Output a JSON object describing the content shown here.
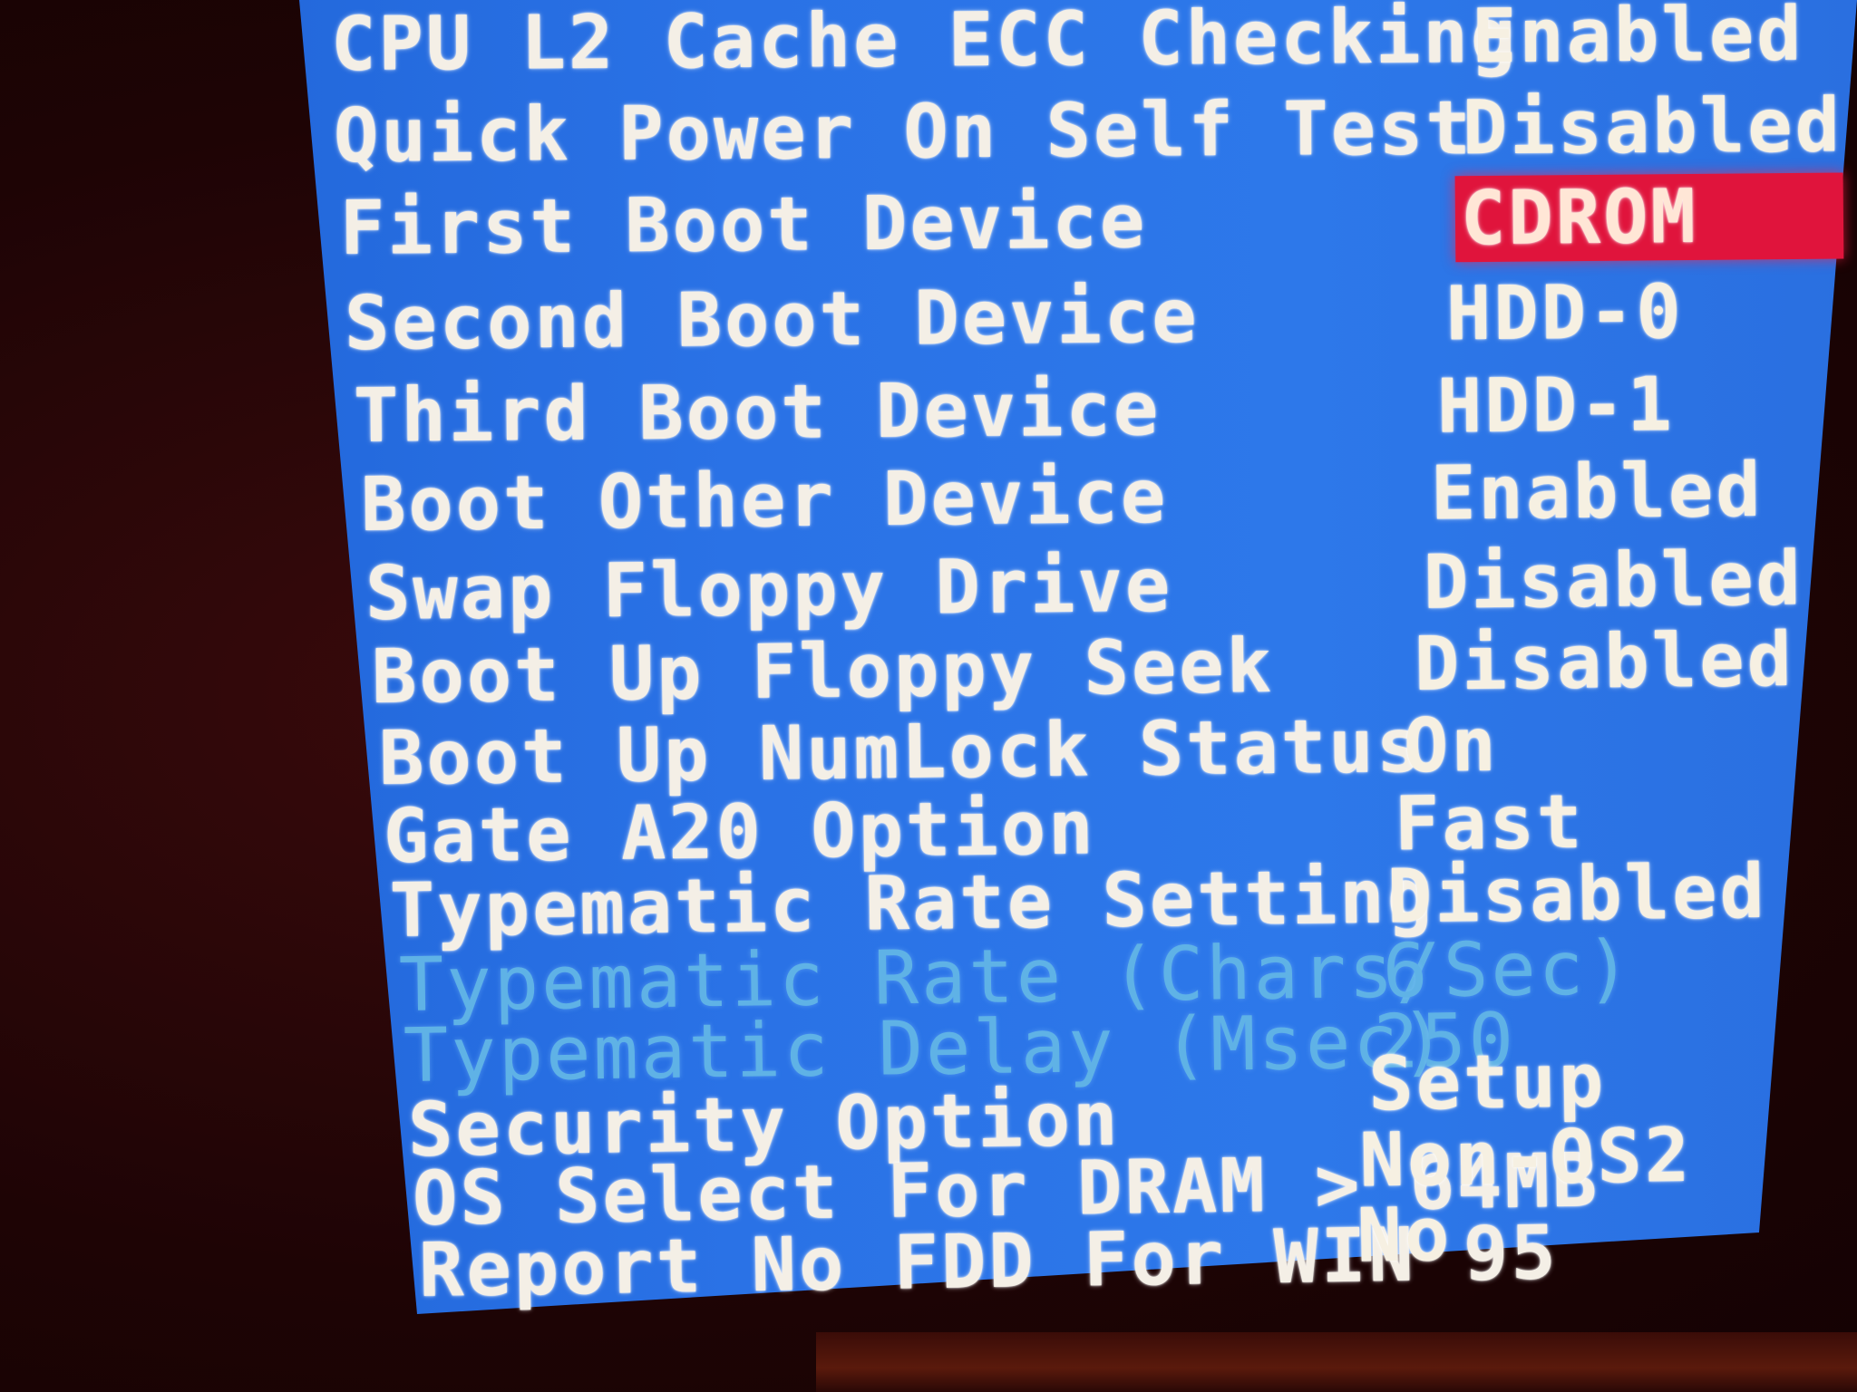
{
  "settings": [
    {
      "label": "CPU L2 Cache ECC Checking",
      "value": "Enabled"
    },
    {
      "label": "Quick Power On Self Test",
      "value": "Disabled"
    },
    {
      "label": "First Boot Device",
      "value": "CDROM",
      "selected": true
    },
    {
      "label": "Second Boot Device",
      "value": "HDD-0"
    },
    {
      "label": "Third Boot Device",
      "value": "HDD-1"
    },
    {
      "label": "Boot Other Device",
      "value": "Enabled"
    },
    {
      "label": "Swap Floppy Drive",
      "value": "Disabled"
    },
    {
      "label": "Boot Up Floppy Seek",
      "value": "Disabled"
    },
    {
      "label": "Boot Up NumLock Status",
      "value": "On"
    },
    {
      "label": "Gate A20 Option",
      "value": "Fast"
    },
    {
      "label": "Typematic Rate Setting",
      "value": "Disabled"
    },
    {
      "label": "Typematic Rate (Chars/Sec)",
      "value": "6",
      "disabled": true
    },
    {
      "label": "Typematic Delay (Msec)",
      "value": "250",
      "disabled": true
    },
    {
      "label": "Security Option",
      "value": "Setup"
    },
    {
      "label": "OS Select For DRAM > 64MB",
      "value": "Non-OS2"
    },
    {
      "label": "Report No FDD For WIN 95",
      "value": "No"
    }
  ],
  "colors": {
    "screen_background": "#2a72e6",
    "text": "#f4efe6",
    "disabled_text": "#5fb2e6",
    "selection_highlight": "#e0143c",
    "bezel": "#1e0405"
  }
}
